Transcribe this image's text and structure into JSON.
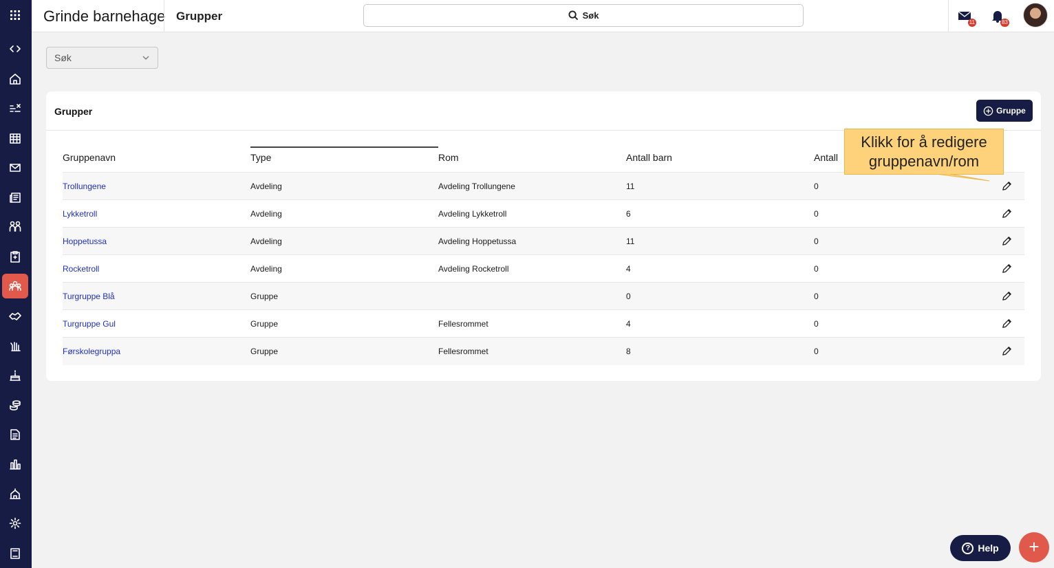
{
  "app": {
    "title": "Grinde barnehage",
    "page_title": "Grupper"
  },
  "top_search": {
    "label": "Søk"
  },
  "notifications": {
    "messages_count": "11",
    "alerts_count": "83"
  },
  "filter": {
    "label": "Søk"
  },
  "card": {
    "title": "Grupper",
    "add_button": "Gruppe"
  },
  "table": {
    "headers": [
      "Gruppenavn",
      "Type",
      "Rom",
      "Antall barn",
      "Antall"
    ],
    "rows": [
      {
        "name": "Trollungene",
        "type": "Avdeling",
        "room": "Avdeling Trollungene",
        "children": "11",
        "count": "0"
      },
      {
        "name": "Lykketroll",
        "type": "Avdeling",
        "room": "Avdeling Lykketroll",
        "children": "6",
        "count": "0"
      },
      {
        "name": "Hoppetussa",
        "type": "Avdeling",
        "room": "Avdeling Hoppetussa",
        "children": "11",
        "count": "0"
      },
      {
        "name": "Rocketroll",
        "type": "Avdeling",
        "room": "Avdeling Rocketroll",
        "children": "4",
        "count": "0"
      },
      {
        "name": "Turgruppe Blå",
        "type": "Gruppe",
        "room": "",
        "children": "0",
        "count": "0"
      },
      {
        "name": "Turgruppe Gul",
        "type": "Gruppe",
        "room": "Fellesrommet",
        "children": "4",
        "count": "0"
      },
      {
        "name": "Førskolegruppa",
        "type": "Gruppe",
        "room": "Fellesrommet",
        "children": "8",
        "count": "0"
      }
    ]
  },
  "tooltip": {
    "line1": "Klikk for å redigere",
    "line2": "gruppenavn/rom"
  },
  "help_button": {
    "label": "Help",
    "icon_glyph": "?"
  },
  "fab": {
    "label": "+"
  },
  "sidebar": {
    "items": [
      "apps-grid-icon",
      "collapse-toggle-icon",
      "home-icon",
      "tasks-icon",
      "calendar-icon",
      "mail-icon",
      "news-icon",
      "children-icon",
      "clipboard-icon",
      "groups-icon",
      "handshake-icon",
      "hand-icon",
      "birthday-icon",
      "payments-icon",
      "documents-icon",
      "statistics-icon",
      "kindergarten-icon",
      "settings-icon",
      "book-icon"
    ],
    "active": "groups-icon"
  },
  "colors": {
    "navy": "#171c45",
    "accent": "#e0594a",
    "link": "#1f2fc4",
    "tooltip": "#fdd27a"
  }
}
